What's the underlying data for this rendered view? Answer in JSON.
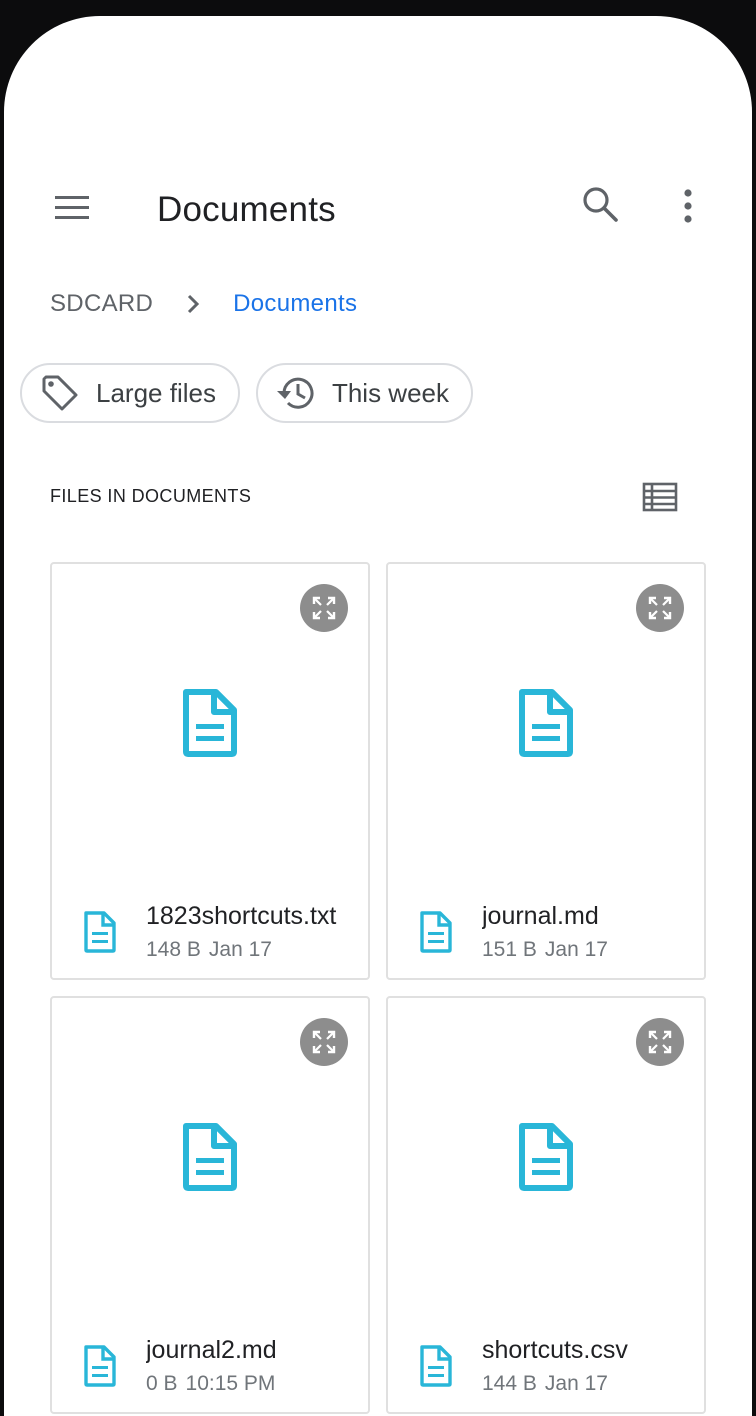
{
  "appbar": {
    "title": "Documents"
  },
  "breadcrumb": {
    "root": "SDCARD",
    "current": "Documents"
  },
  "chips": [
    {
      "label": "Large files",
      "icon": "tag-icon"
    },
    {
      "label": "This week",
      "icon": "history-icon"
    }
  ],
  "section": {
    "title": "FILES IN DOCUMENTS"
  },
  "files": [
    {
      "name": "1823shortcuts.txt",
      "size": "148 B",
      "date": "Jan 17"
    },
    {
      "name": "journal.md",
      "size": "151 B",
      "date": "Jan 17"
    },
    {
      "name": "journal2.md",
      "size": "0 B",
      "date": "10:15 PM"
    },
    {
      "name": "shortcuts.csv",
      "size": "144 B",
      "date": "Jan 17"
    }
  ],
  "colors": {
    "accent": "#1a73e8",
    "file_icon": "#29b6d8",
    "expand_bg": "#8d8d8d"
  }
}
